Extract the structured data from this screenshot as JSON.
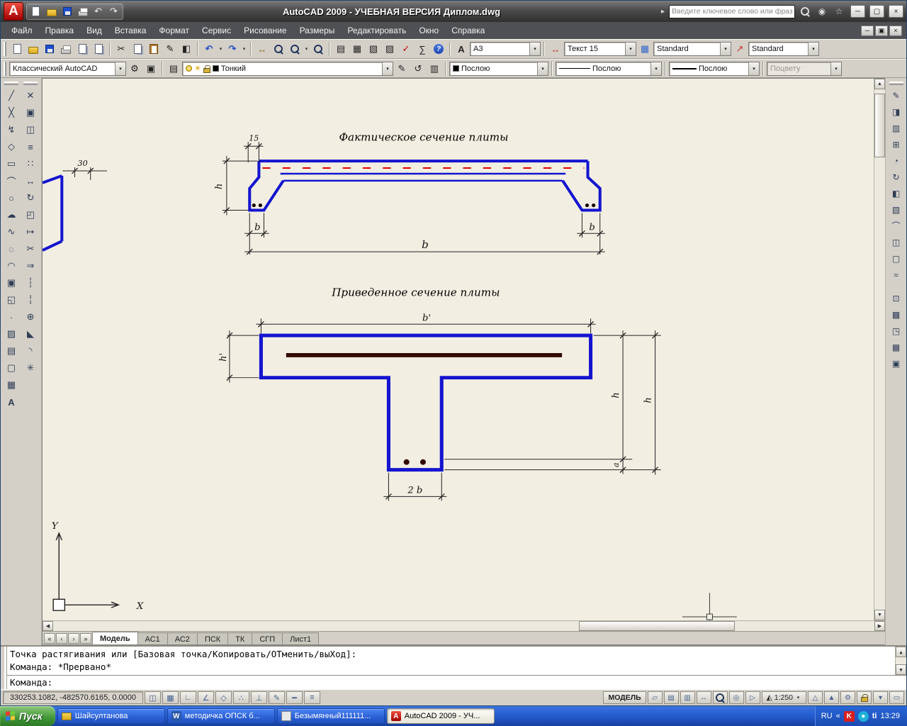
{
  "titlebar": {
    "title": "AutoCAD 2009 - УЧЕБНАЯ ВЕРСИЯ Диплом.dwg",
    "search_placeholder": "Введите ключевое слово или фразу"
  },
  "menu": [
    "Файл",
    "Правка",
    "Вид",
    "Вставка",
    "Формат",
    "Сервис",
    "Рисование",
    "Размеры",
    "Редактировать",
    "Окно",
    "Справка"
  ],
  "toolbar1": {
    "text_style_combo": "A3",
    "dim_style_combo": "Текст 15",
    "table_style_combo": "Standard",
    "multileader_style_combo": "Standard"
  },
  "toolbar2": {
    "workspace": "Классический AutoCAD",
    "layer": "Тонкий",
    "color": "Послою",
    "linetype": "Послою",
    "lineweight": "Послою",
    "plot_style": "Поцвету"
  },
  "drawing": {
    "fig1": {
      "title": "Фактическое сечение плиты",
      "dim_15": "15",
      "dim_30": "30",
      "dim_h": "h",
      "dim_b_left": "b",
      "dim_b_right": "b",
      "dim_b_total": "b"
    },
    "fig2": {
      "title": "Приведенное сечение плиты",
      "dim_b_top": "b'",
      "dim_h_left": "h'",
      "dim_h_inner": "h",
      "dim_h_outer": "h",
      "dim_a": "a",
      "dim_2b": "2 b"
    },
    "ucs": {
      "x": "X",
      "y": "Y"
    }
  },
  "tabs": {
    "items": [
      "Модель",
      "АС1",
      "АС2",
      "ПСК",
      "ТК",
      "СГП",
      "Лист1"
    ]
  },
  "command": {
    "history1": "Точка растягивания или [Базовая точка/Копировать/ОТменить/выХод]:",
    "history2": "Команда: *Прервано*",
    "prompt": "Команда:"
  },
  "statusbar": {
    "coords": "330253.1082, -482570.6165, 0.0000",
    "model": "МОДЕЛЬ",
    "scale": "1:250"
  },
  "taskbar": {
    "start": "Пуск",
    "tasks": [
      {
        "label": "Шайсултанова"
      },
      {
        "label": "методичка ОПСК б..."
      },
      {
        "label": "Безымянный111111..."
      },
      {
        "label": "AutoCAD 2009 - УЧ..."
      }
    ],
    "tray": {
      "lang": "RU",
      "chevron": "«",
      "antivirus": "K",
      "messenger": "●",
      "snagit": "ti",
      "time": "13:29"
    }
  },
  "icons": {
    "logo": "A",
    "search_arrow": "▸",
    "comm": "◉",
    "star": "☆",
    "min": "─",
    "max": "▢",
    "close": "×",
    "doc_min": "─",
    "doc_restore": "▣",
    "doc_close": "×",
    "cut": "✂",
    "undo": "↶",
    "redo": "↷",
    "dd": "▾",
    "pan": "↔",
    "block_editor": "◧",
    "properties": "▤",
    "designcenter": "▦",
    "tool_palettes": "▧",
    "sheet_set": "▨",
    "markup": "✓",
    "calc": "∑",
    "help": "?",
    "text_style": "A",
    "dim_style": "↔",
    "table_style": "▦",
    "mleader_style": "↗",
    "gear": "⚙",
    "save_ws": "▣",
    "layers": "▤",
    "sun": "☀",
    "layer_make": "✎",
    "layer_prev": "↺",
    "layer_state": "▥",
    "color_sq": "■",
    "draw": [
      "╱",
      "╳",
      "↯",
      "◇",
      "▭",
      "⌒",
      "○",
      "☁",
      "∿",
      "◌",
      "◠",
      "▣",
      "◱",
      "∙",
      "▨",
      "▤",
      "▢",
      "▦",
      "A"
    ],
    "modify": [
      "✕",
      "▣",
      "◫",
      "≡",
      "∷",
      "↔",
      "↻",
      "◰",
      "↦",
      "✂",
      "⇒",
      "┆",
      "╎",
      "⊕",
      "◣",
      "◝",
      "✳"
    ],
    "right": [
      "✎",
      "◨",
      "▥",
      "⊞",
      "◔",
      "↻",
      "◧",
      "▧",
      "⌒",
      "◫",
      "▢",
      "≈",
      "⊡",
      "▩",
      "◳",
      "▦",
      "▣"
    ],
    "status": [
      "◫",
      "▦",
      "∟",
      "∠",
      "◇",
      "∴",
      "⊥",
      "✎",
      "━",
      "≡"
    ],
    "nav": {
      "first": "«",
      "prev": "‹",
      "next": "›",
      "last": "»"
    },
    "scroll": {
      "up": "▲",
      "down": "▼",
      "left": "◀",
      "right": "▶"
    },
    "st_right": {
      "layout": "▱",
      "qvd": "▥",
      "qvl": "▤",
      "steer": "◎",
      "motion": "▷",
      "scaleic": "◭",
      "annvis": "△",
      "annauto": "▲",
      "menu": "▾",
      "clean": "▭"
    },
    "task_word": "W",
    "task_acad": "A"
  }
}
